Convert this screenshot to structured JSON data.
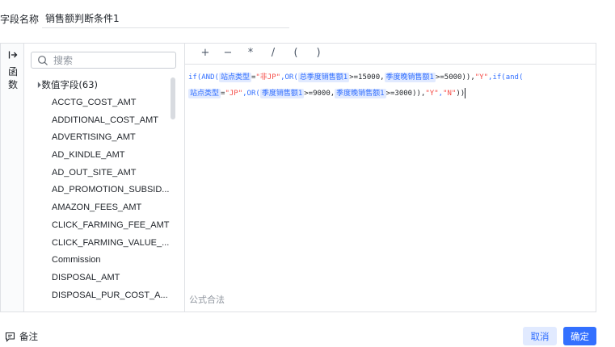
{
  "field_name": {
    "label": "字段名称",
    "value": "销售额判断条件1"
  },
  "side_tabs": {
    "functions_label": "函数"
  },
  "search": {
    "placeholder": "搜索"
  },
  "field_group": {
    "title": "数值字段(63)",
    "items": [
      "ACCTG_COST_AMT",
      "ADDITIONAL_COST_AMT",
      "ADVERTISING_AMT",
      "AD_KINDLE_AMT",
      "AD_OUT_SITE_AMT",
      "AD_PROMOTION_SUBSID...",
      "AMAZON_FEES_AMT",
      "CLICK_FARMING_FEE_AMT",
      "CLICK_FARMING_VALUE_...",
      "Commission",
      "DISPOSAL_AMT",
      "DISPOSAL_PUR_COST_A..."
    ]
  },
  "operators": [
    "+",
    "−",
    "*",
    "/",
    "(",
    ")"
  ],
  "formula": {
    "fn_if": "if",
    "fn_and": "AND",
    "fn_or": "OR",
    "fn_and_lower": "and",
    "field_site_type": "站点类型",
    "field_season_total": "总季度销售额1",
    "field_season_late": "季度晚销售额1",
    "field_season_sales": "季度销售额1",
    "str_not_jp": "\"非JP\"",
    "str_jp": "\"JP\"",
    "str_y": "\"Y\"",
    "str_n": "\"N\"",
    "num_15000": ">=15000,",
    "num_5000": ">=5000)),",
    "num_9000": ">=9000,",
    "num_3000": ">=3000)),",
    "eq": "=",
    "comma": ",",
    "close_paren": "))"
  },
  "status_text": "公式合法",
  "footer": {
    "remark_label": "备注",
    "cancel_label": "取消",
    "confirm_label": "确定"
  },
  "colors": {
    "accent": "#3370ff",
    "field_chip_bg": "#e1eaff",
    "string_red": "#f54a45"
  }
}
